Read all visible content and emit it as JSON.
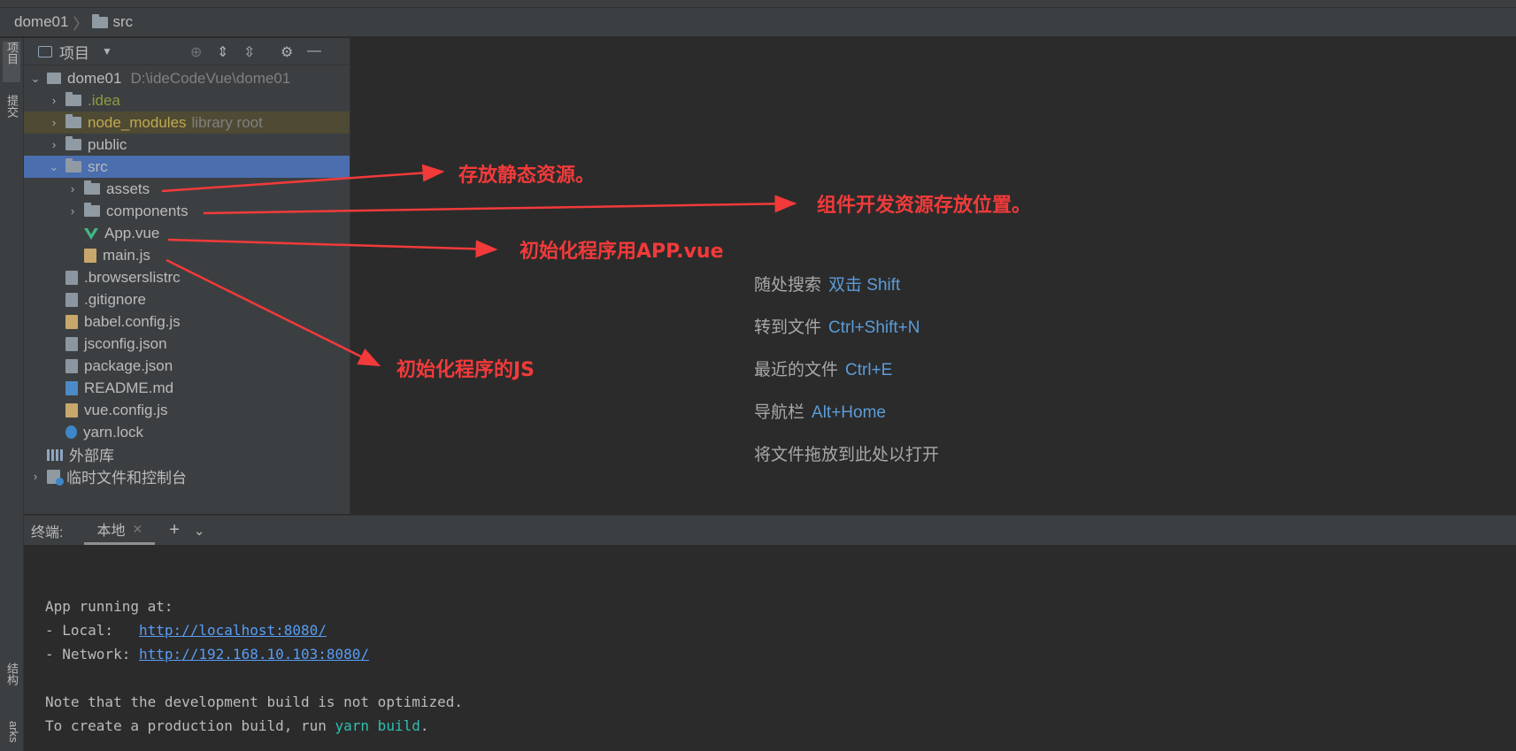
{
  "breadcrumb": {
    "project": "dome01",
    "folder": "src"
  },
  "leftbar": {
    "project_tab": "项目",
    "commit_tab": "提交",
    "structure_tab": "结构",
    "bookmarks_tab": "arks"
  },
  "panel": {
    "title": "项目"
  },
  "tree": {
    "root": {
      "name": "dome01",
      "path": "D:\\ideCodeVue\\dome01"
    },
    "idea": ".idea",
    "node_modules": {
      "name": "node_modules",
      "hint": "library root"
    },
    "public": "public",
    "src": "src",
    "assets": "assets",
    "components": "components",
    "app_vue": "App.vue",
    "main_js": "main.js",
    "browserslistrc": ".browserslistrc",
    "gitignore": ".gitignore",
    "babel": "babel.config.js",
    "jsconfig": "jsconfig.json",
    "package": "package.json",
    "readme": "README.md",
    "vueconfig": "vue.config.js",
    "yarnlock": "yarn.lock",
    "external": "外部库",
    "scratches": "临时文件和控制台"
  },
  "editor_hints": [
    {
      "label": "随处搜索",
      "key": "双击 Shift"
    },
    {
      "label": "转到文件",
      "key": "Ctrl+Shift+N"
    },
    {
      "label": "最近的文件",
      "key": "Ctrl+E"
    },
    {
      "label": "导航栏",
      "key": "Alt+Home"
    },
    {
      "label": "将文件拖放到此处以打开",
      "key": ""
    }
  ],
  "annotations": {
    "assets": "存放静态资源。",
    "components": "组件开发资源存放位置。",
    "app": "初始化程序用APP.vue",
    "main": "初始化程序的JS"
  },
  "terminal": {
    "label": "终端:",
    "tab": "本地",
    "lines": {
      "running": "App running at:",
      "local_label": "- Local:   ",
      "local_url": "http://localhost:8080/",
      "network_label": "- Network: ",
      "network_url": "http://192.168.10.103:8080/",
      "note": "Note that the development build is not optimized.",
      "prod_prefix": "To create a production build, run ",
      "prod_cmd": "yarn build",
      "prod_suffix": "."
    }
  },
  "colors": {
    "selection": "#4b6eaf",
    "annotation": "#f23a3a",
    "link": "#589df6",
    "command": "#2fbfb0"
  }
}
